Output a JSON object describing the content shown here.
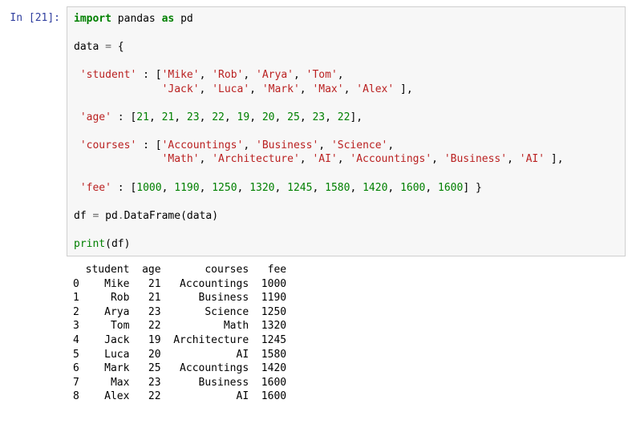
{
  "prompt": {
    "label": "In [",
    "num": "21",
    "close": "]:"
  },
  "code": {
    "line1": {
      "import": "import",
      "pandas": "pandas",
      "as": "as",
      "pd": "pd"
    },
    "line3": {
      "data": "data",
      "eq": "=",
      "brace": "{"
    },
    "student_key": "'student'",
    "colon": ":",
    "lb": "[",
    "rb": "]",
    "comma": ",",
    "students": [
      "'Mike'",
      "'Rob'",
      "'Arya'",
      "'Tom'",
      "'Jack'",
      "'Luca'",
      "'Mark'",
      "'Max'",
      "'Alex'"
    ],
    "age_key": "'age'",
    "ages": [
      "21",
      "21",
      "23",
      "22",
      "19",
      "20",
      "25",
      "23",
      "22"
    ],
    "courses_key": "'courses'",
    "courses": [
      "'Accountings'",
      "'Business'",
      "'Science'",
      "'Math'",
      "'Architecture'",
      "'AI'",
      "'Accountings'",
      "'Business'",
      "'AI'"
    ],
    "fee_key": "'fee'",
    "fees": [
      "1000",
      "1190",
      "1250",
      "1320",
      "1245",
      "1580",
      "1420",
      "1600",
      "1600"
    ],
    "rbrace": "}",
    "df": "df",
    "pdDataFrame_pd": "pd",
    "dot": ".",
    "DataFrame": "DataFrame",
    "lparen": "(",
    "rparen": ")",
    "data_arg": "data",
    "print": "print",
    "df_arg": "df"
  },
  "output": {
    "header": "  student  age       courses   fee",
    "rows": [
      "0    Mike   21   Accountings  1000",
      "1     Rob   21      Business  1190",
      "2    Arya   23       Science  1250",
      "3     Tom   22          Math  1320",
      "4    Jack   19  Architecture  1245",
      "5    Luca   20            AI  1580",
      "6    Mark   25   Accountings  1420",
      "7     Max   23      Business  1600",
      "8    Alex   22            AI  1600"
    ]
  }
}
